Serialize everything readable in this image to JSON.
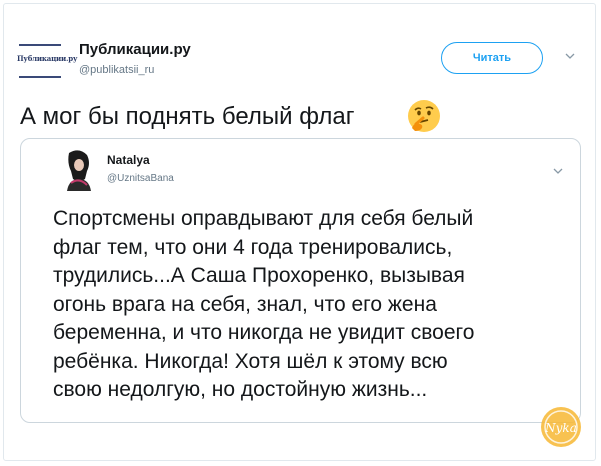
{
  "tweet": {
    "author_name": "Публикации.ру",
    "author_handle": "@publikatsii_ru",
    "avatar_logo_text": "Публикации.ру",
    "follow_label": "Читать",
    "text": "А мог бы поднять белый флаг",
    "emoji": "thinking-face-emoji"
  },
  "quoted": {
    "author_name": "Natalya",
    "author_handle": "@UznitsaBana",
    "lines": [
      "Спортсмены оправдывают для себя белый",
      "флаг тем, что они 4 года тренировались,",
      "трудились...А Саша Прохоренко, вызывая",
      "огонь врага на себя, знал, что его жена",
      "беременна, и что никогда не увидит своего",
      "ребёнка. Никогда! Хотя шёл к этому всю",
      "свою недолгую, но достойную жизнь..."
    ]
  },
  "watermark_text": "Nyka",
  "colors": {
    "accent": "#1da1f2",
    "text": "#14171a",
    "muted": "#657786",
    "border": "#ccd6dd"
  }
}
